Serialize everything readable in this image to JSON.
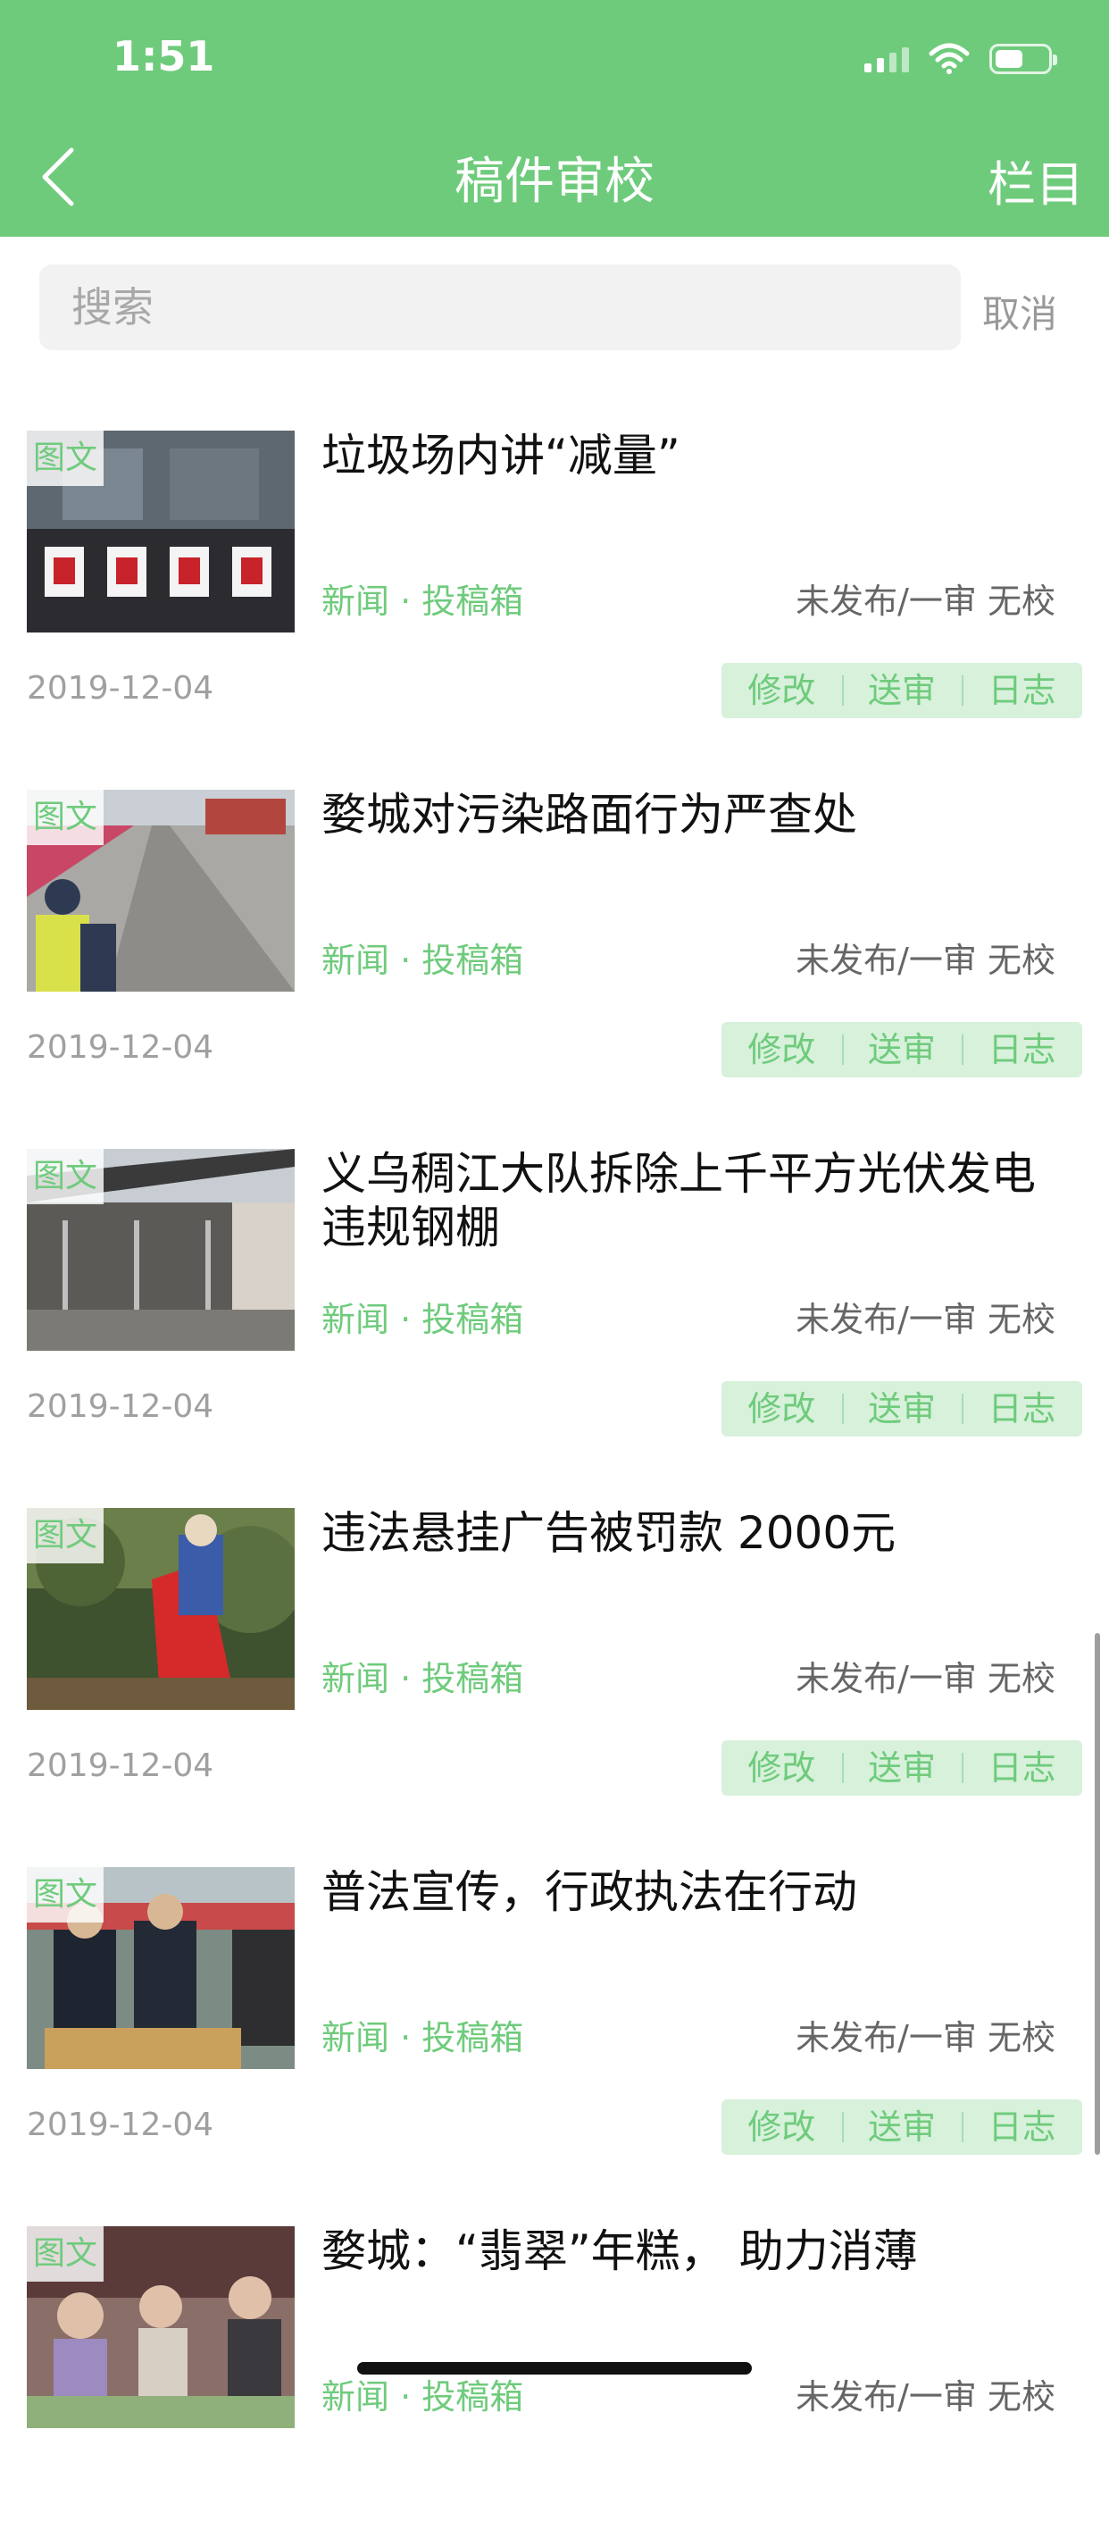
{
  "status_bar": {
    "time": "1:51"
  },
  "nav": {
    "title": "稿件审校",
    "right_label": "栏目"
  },
  "search": {
    "placeholder": "搜索",
    "cancel_label": "取消"
  },
  "colors": {
    "brand": "#6FCB7C",
    "action_bg": "#D7F1DB"
  },
  "articles": [
    {
      "tag": "图文",
      "title": "垃圾场内讲“减量”",
      "category": "新闻 · 投稿箱",
      "status": "未发布/一审 无校",
      "date": "2019-12-04",
      "actions": [
        "修改",
        "送审",
        "日志"
      ]
    },
    {
      "tag": "图文",
      "title": "婺城对污染路面行为严查处",
      "category": "新闻 · 投稿箱",
      "status": "未发布/一审 无校",
      "date": "2019-12-04",
      "actions": [
        "修改",
        "送审",
        "日志"
      ]
    },
    {
      "tag": "图文",
      "title": "义乌稠江大队拆除上千平方光伏发电违规钢棚",
      "category": "新闻 · 投稿箱",
      "status": "未发布/一审 无校",
      "date": "2019-12-04",
      "actions": [
        "修改",
        "送审",
        "日志"
      ]
    },
    {
      "tag": "图文",
      "title": "违法悬挂广告被罚款 2000元",
      "category": "新闻 · 投稿箱",
      "status": "未发布/一审 无校",
      "date": "2019-12-04",
      "actions": [
        "修改",
        "送审",
        "日志"
      ]
    },
    {
      "tag": "图文",
      "title": "普法宣传，行政执法在行动",
      "category": "新闻 · 投稿箱",
      "status": "未发布/一审 无校",
      "date": "2019-12-04",
      "actions": [
        "修改",
        "送审",
        "日志"
      ]
    },
    {
      "tag": "图文",
      "title": "婺城：“翡翠”年糕， 助力消薄",
      "category": "新闻 · 投稿箱",
      "status": "未发布/一审 无校",
      "date": "",
      "actions": []
    }
  ]
}
